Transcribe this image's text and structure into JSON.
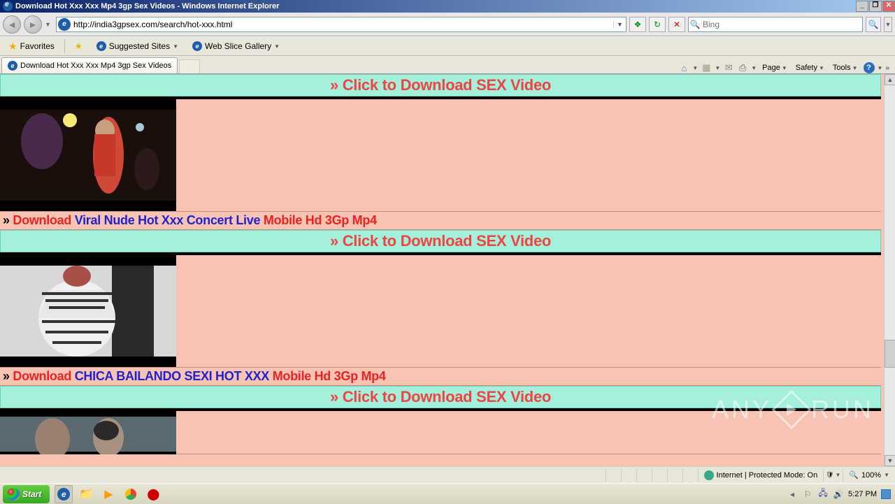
{
  "window": {
    "title": "Download Hot Xxx Xxx Mp4 3gp Sex Videos - Windows Internet Explorer"
  },
  "nav": {
    "url": "http://india3gpsex.com/search/hot-xxx.html",
    "search_placeholder": "Bing"
  },
  "favbar": {
    "favorites": "Favorites",
    "suggested": "Suggested Sites",
    "webslice": "Web Slice Gallery"
  },
  "tab": {
    "title": "Download Hot Xxx Xxx Mp4 3gp Sex Videos"
  },
  "command": {
    "page": "Page",
    "safety": "Safety",
    "tools": "Tools"
  },
  "page": {
    "banner": "» Click to Download SEX Video",
    "items": [
      {
        "arrow": "»",
        "dl": "Download",
        "title": "Viral Nude Hot Xxx Concert Live",
        "fmt": "Mobile Hd 3Gp Mp4"
      },
      {
        "arrow": "»",
        "dl": "Download",
        "title": "CHICA BAILANDO SEXI HOT XXX",
        "fmt": "Mobile Hd 3Gp Mp4"
      }
    ]
  },
  "status": {
    "zone": "Internet | Protected Mode: On",
    "zoom": "100%"
  },
  "taskbar": {
    "start": "Start",
    "time": "5:27 PM"
  },
  "watermark": {
    "a": "ANY",
    "b": "RUN"
  }
}
